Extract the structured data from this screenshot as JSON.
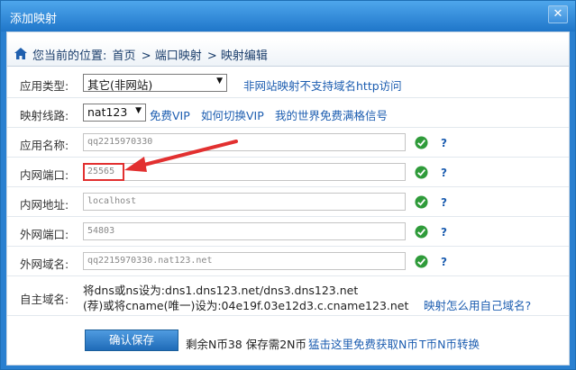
{
  "window": {
    "title": "添加映射",
    "close_glyph": "✕"
  },
  "breadcrumb": {
    "prefix": "您当前的位置:",
    "items": [
      "首页",
      "> 端口映射",
      "> 映射编辑"
    ]
  },
  "app_type": {
    "label": "应用类型:",
    "value": "其它(非网站)",
    "note": "非网站映射不支持域名http访问"
  },
  "route": {
    "label": "映射线路:",
    "value": "nat123",
    "links": [
      "免费VIP",
      "如何切换VIP",
      "我的世界免费满格信号"
    ]
  },
  "app_name": {
    "label": "应用名称:",
    "value": "qq2215970330"
  },
  "lan_port": {
    "label": "内网端口:",
    "value": "25565"
  },
  "lan_addr": {
    "label": "内网地址:",
    "value": "localhost"
  },
  "wan_port": {
    "label": "外网端口:",
    "value": "54803"
  },
  "wan_domain": {
    "label": "外网域名:",
    "value": "qq2215970330.nat123.net"
  },
  "custom_domain": {
    "label": "自主域名:",
    "line1": "将dns或ns设为:dns1.dns123.net/dns3.dns123.net",
    "line2": "(荐)或将cname(唯一)设为:04e19f.03e12d3.c.cname123.net",
    "link": "映射怎么用自己域名?"
  },
  "help_glyph": "?",
  "footer": {
    "save_label": "确认保存",
    "remaining": "剩余N币38 保存需2N币",
    "free_link": "猛击这里免费获取N币",
    "convert_link": "T币N币转换"
  },
  "colors": {
    "accent": "#1f76c9",
    "link": "#1c5db0",
    "check": "#2f9b3a",
    "annotation": "#e23030"
  }
}
